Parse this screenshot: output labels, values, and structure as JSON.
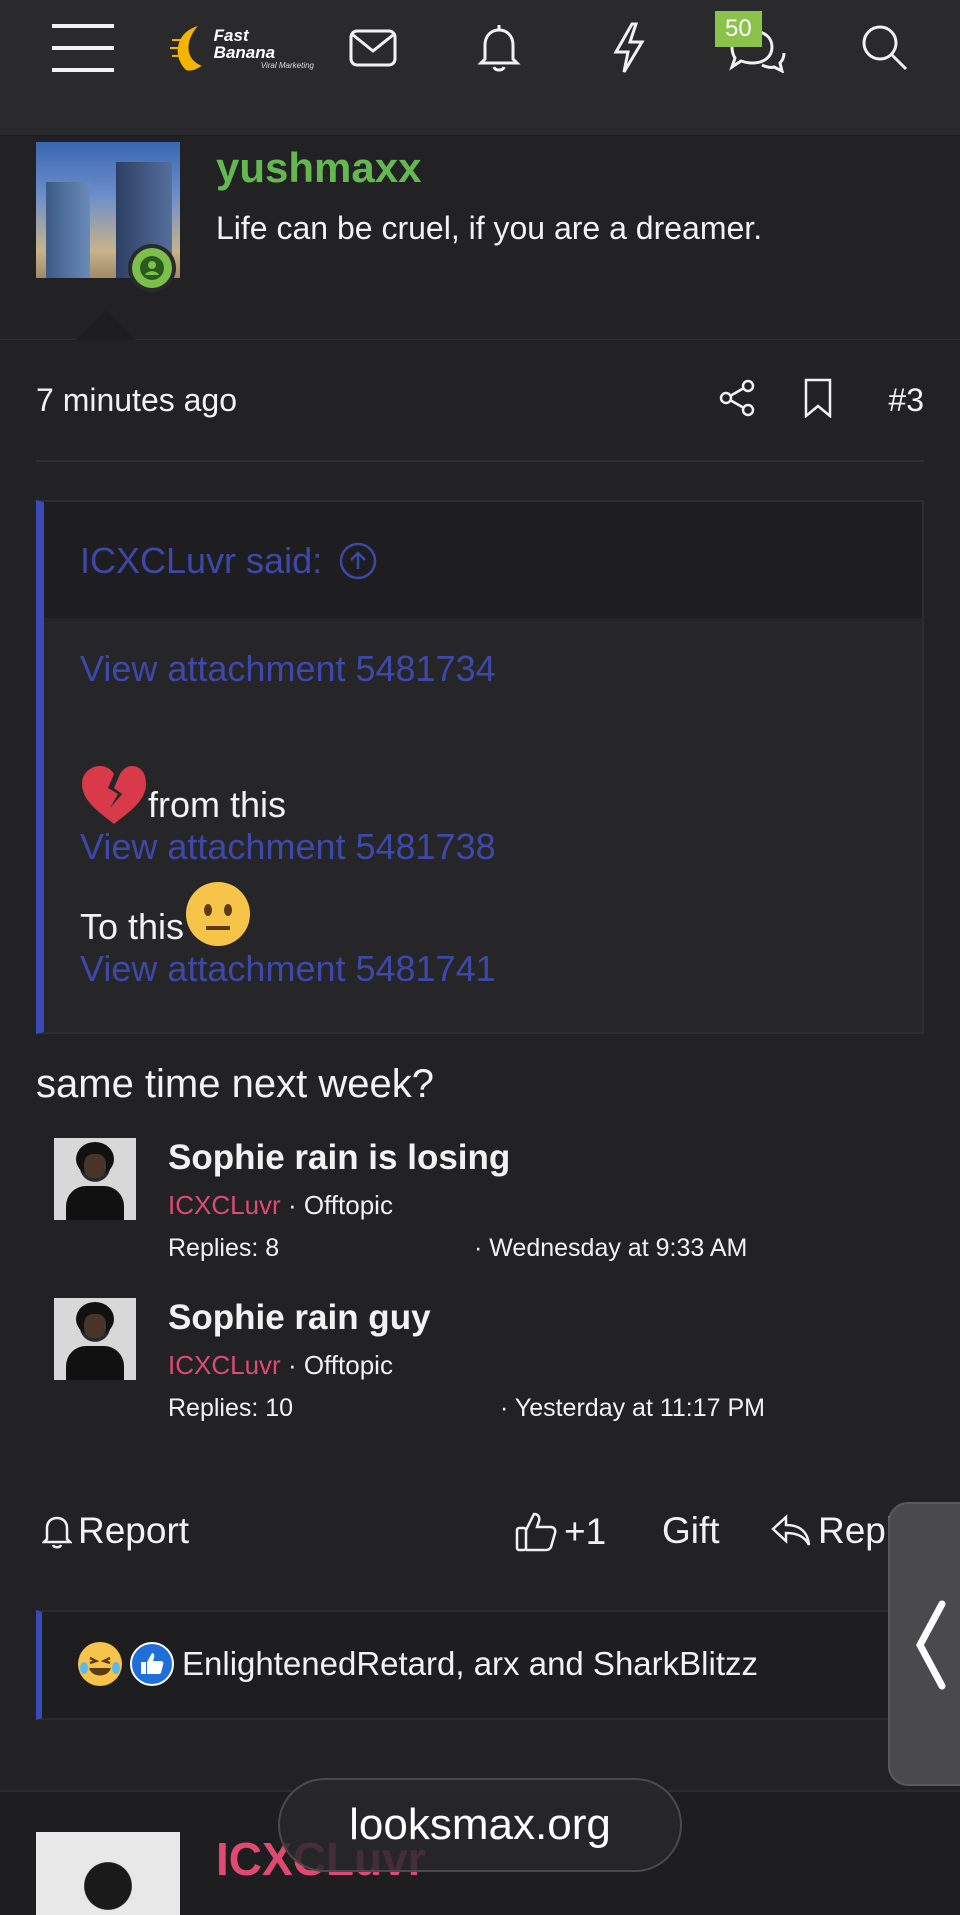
{
  "nav": {
    "brand": "Fast Banana",
    "brand_sub": "Viral Marketing",
    "chat_badge": "50",
    "icons": [
      "menu-icon",
      "mail-icon",
      "bell-icon",
      "bolt-icon",
      "chat-icon",
      "search-icon"
    ]
  },
  "author": {
    "username": "yushmaxx",
    "title": "Life can be cruel, if you are a dreamer.",
    "status": "online"
  },
  "post": {
    "time": "7 minutes ago",
    "number": "#3"
  },
  "quote": {
    "author": "ICXCLuvr said:",
    "attach1": "View attachment 5481734",
    "line1": "from this",
    "attach2": "View attachment 5481738",
    "line2": "To this",
    "attach3": "View attachment 5481741"
  },
  "reply": "same time next week?",
  "threads": [
    {
      "title": "Sophie rain is losing",
      "user": "ICXCLuvr",
      "forum": "Offtopic",
      "replies": "Replies: 8",
      "date": "Wednesday at 9:33 AM"
    },
    {
      "title": "Sophie rain guy",
      "user": "ICXCLuvr",
      "forum": "Offtopic",
      "replies": "Replies: 10",
      "date": "Yesterday at 11:17 PM"
    }
  ],
  "actions": {
    "report": "Report",
    "like": "+1",
    "gift": "Gift",
    "reply": "Reply"
  },
  "reactions": {
    "names": "EnlightenedRetard, arx and SharkBlitzz"
  },
  "next_post": {
    "username": "ICXCLuvr"
  },
  "url": "looksmax.org",
  "colors": {
    "background": "#222224",
    "username_green": "#64b84f",
    "quote_blue": "#3d48a8",
    "user_pink": "#e04a72",
    "badge_green": "#8bc34a"
  }
}
